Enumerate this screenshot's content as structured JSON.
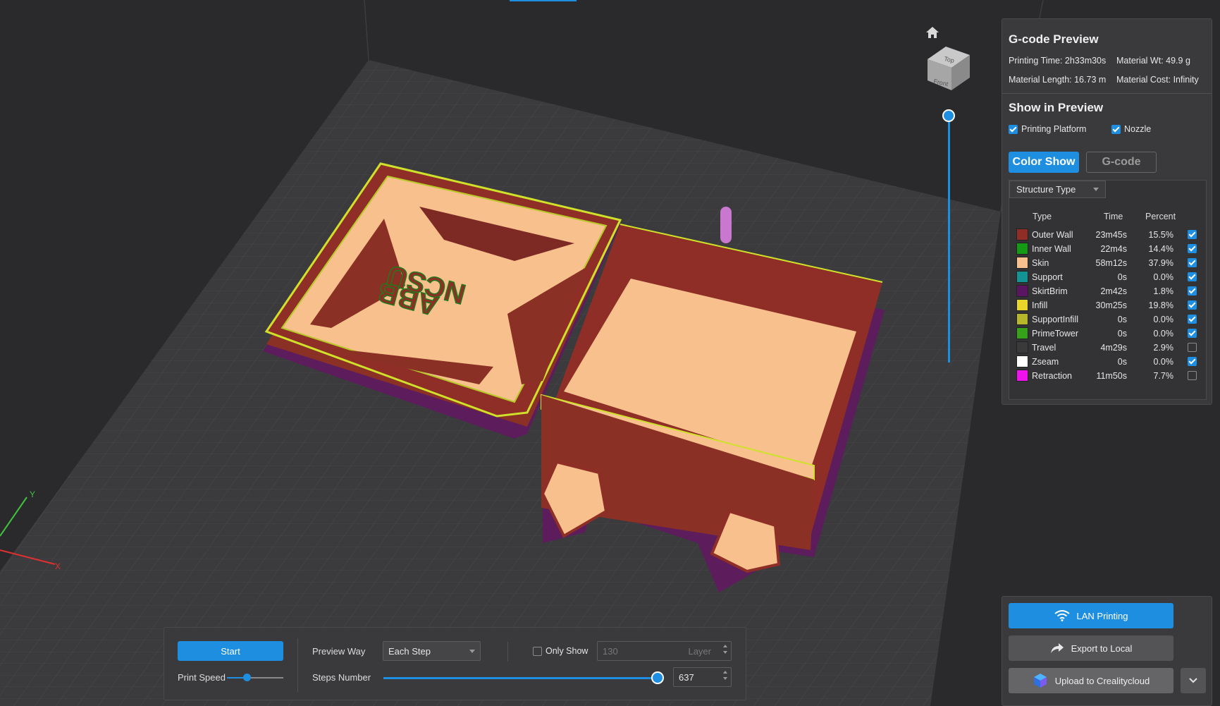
{
  "gcode_preview": {
    "title": "G-code Preview",
    "printing_time": "Printing Time: 2h33m30s",
    "material_wt": "Material Wt: 49.9 g",
    "material_length": "Material Length: 16.73 m",
    "material_cost": "Material Cost: Infinity"
  },
  "show_in_preview": {
    "title": "Show in Preview",
    "printing_platform": "Printing Platform",
    "nozzle": "Nozzle"
  },
  "tabs": {
    "color_show": "Color Show",
    "gcode": "G-code"
  },
  "structure": {
    "selector": "Structure Type",
    "headers": {
      "type": "Type",
      "time": "Time",
      "percent": "Percent"
    },
    "rows": [
      {
        "type": "Outer Wall",
        "time": "23m45s",
        "percent": "15.5%",
        "color": "#8e2e26",
        "checked": true
      },
      {
        "type": "Inner Wall",
        "time": "22m4s",
        "percent": "14.4%",
        "color": "#149a14",
        "checked": true
      },
      {
        "type": "Skin",
        "time": "58m12s",
        "percent": "37.9%",
        "color": "#f7c08d",
        "checked": true
      },
      {
        "type": "Support",
        "time": "0s",
        "percent": "0.0%",
        "color": "#139393",
        "checked": true
      },
      {
        "type": "SkirtBrim",
        "time": "2m42s",
        "percent": "1.8%",
        "color": "#5a1660",
        "checked": true
      },
      {
        "type": "Infill",
        "time": "30m25s",
        "percent": "19.8%",
        "color": "#e8d62a",
        "checked": true
      },
      {
        "type": "SupportInfill",
        "time": "0s",
        "percent": "0.0%",
        "color": "#b7b72c",
        "checked": true
      },
      {
        "type": "PrimeTower",
        "time": "0s",
        "percent": "0.0%",
        "color": "#37a11a",
        "checked": true
      },
      {
        "type": "Travel",
        "time": "4m29s",
        "percent": "2.9%",
        "color": "#3a3a3a",
        "checked": false
      },
      {
        "type": "Zseam",
        "time": "0s",
        "percent": "0.0%",
        "color": "#ffffff",
        "checked": true
      },
      {
        "type": "Retraction",
        "time": "11m50s",
        "percent": "7.7%",
        "color": "#ee12ee",
        "checked": false
      }
    ]
  },
  "navcube": {
    "top": "Top",
    "front": "Front"
  },
  "toolbar": {
    "start": "Start",
    "print_speed": "Print Speed",
    "print_speed_level": 0.35,
    "preview_way": "Preview Way",
    "preview_way_value": "Each Step",
    "only_show": "Only Show",
    "layer_value": "130",
    "layer_label": "Layer",
    "steps_number": "Steps Number",
    "steps_value": "637",
    "steps_level": 1.0
  },
  "export": {
    "lan": "LAN Printing",
    "local": "Export to Local",
    "cloud": "Upload to Crealitycloud"
  },
  "axes": {
    "x": "X",
    "y": "Y"
  }
}
